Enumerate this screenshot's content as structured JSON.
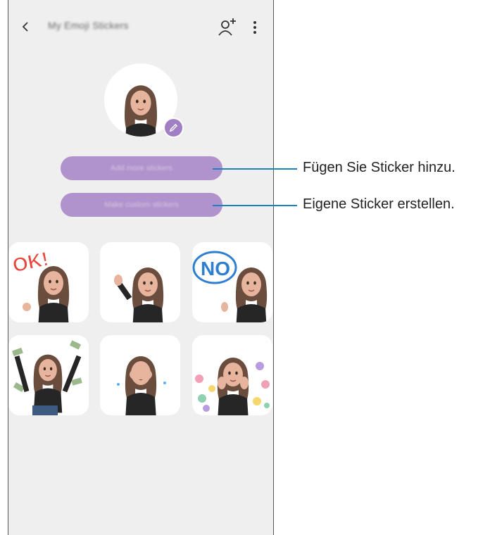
{
  "header": {
    "title": "My Emoji Stickers",
    "back_icon": "chevron-left-icon",
    "add_icon": "add-emoji-icon",
    "more_icon": "more-vert-icon"
  },
  "avatar": {
    "edit_icon": "pencil-icon"
  },
  "buttons": {
    "add_more": "Add more stickers",
    "make_custom": "Make custom stickers"
  },
  "callouts": {
    "add_more": "Fügen Sie Sticker hinzu.",
    "make_custom": "Eigene Sticker erstellen."
  },
  "stickers": [
    {
      "name": "ok",
      "text": "OK!"
    },
    {
      "name": "wave",
      "text": ""
    },
    {
      "name": "no",
      "text": "NO"
    },
    {
      "name": "money",
      "text": ""
    },
    {
      "name": "cry",
      "text": ""
    },
    {
      "name": "hearts",
      "text": ""
    }
  ],
  "colors": {
    "accent": "#b092cc",
    "callout_line": "#1f7fbf",
    "screen_bg": "#efefef"
  }
}
